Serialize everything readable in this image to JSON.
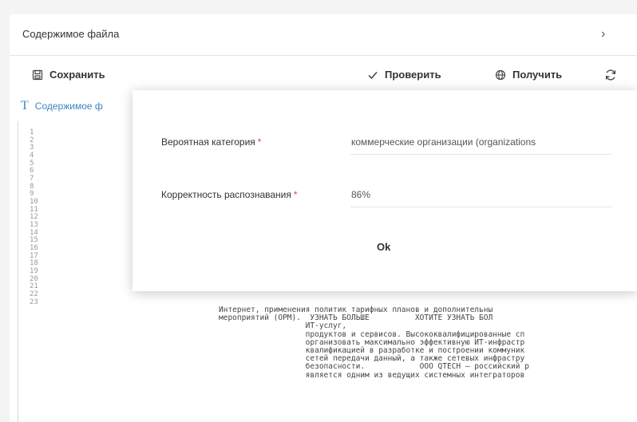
{
  "section": {
    "title": "Содержимое файла"
  },
  "toolbar": {
    "save_label": "Сохранить",
    "check_label": "Проверить",
    "get_label": "Получить",
    "icons": [
      "save-icon",
      "check-icon",
      "globe-icon",
      "refresh-icon"
    ]
  },
  "editor": {
    "label": "Содержимое ф",
    "line_numbers": [
      "1",
      "2",
      "3",
      "4",
      "5",
      "6",
      "7",
      "8",
      "9",
      "10",
      "11",
      "12",
      "13",
      "14",
      "15",
      "16",
      "17",
      "18",
      "19",
      "20",
      "21",
      "22",
      "23"
    ],
    "lines": [
      "Интернет, применения политик тарифных планов и дополнительны",
      "мероприятий (ОРМ).  УЗНАТЬ БОЛЬШЕ          ХОТИТЕ УЗНАТЬ БОЛ",
      "                   ИТ-услуг,",
      "                   продуктов и сервисов. Высококвалифицированные сп",
      "                   организовать максимально эффективную ИТ-инфрастр",
      "                   квалификацией в разработке и построении коммуник",
      "                   сетей передачи данный, а также сетевых инфрастру",
      "                   безопасности.            ООО QTECH — российский р",
      "                   является одним из ведущих системных интеграторов"
    ]
  },
  "modal": {
    "category_label": "Вероятная категория",
    "category_value": "коммерческие организации (organizations",
    "accuracy_label": "Корректность распознавания",
    "accuracy_value": "86%",
    "required_mark": "*",
    "ok_label": "Ok"
  },
  "colors": {
    "accent": "#3a86c6",
    "required": "#e0443a"
  }
}
